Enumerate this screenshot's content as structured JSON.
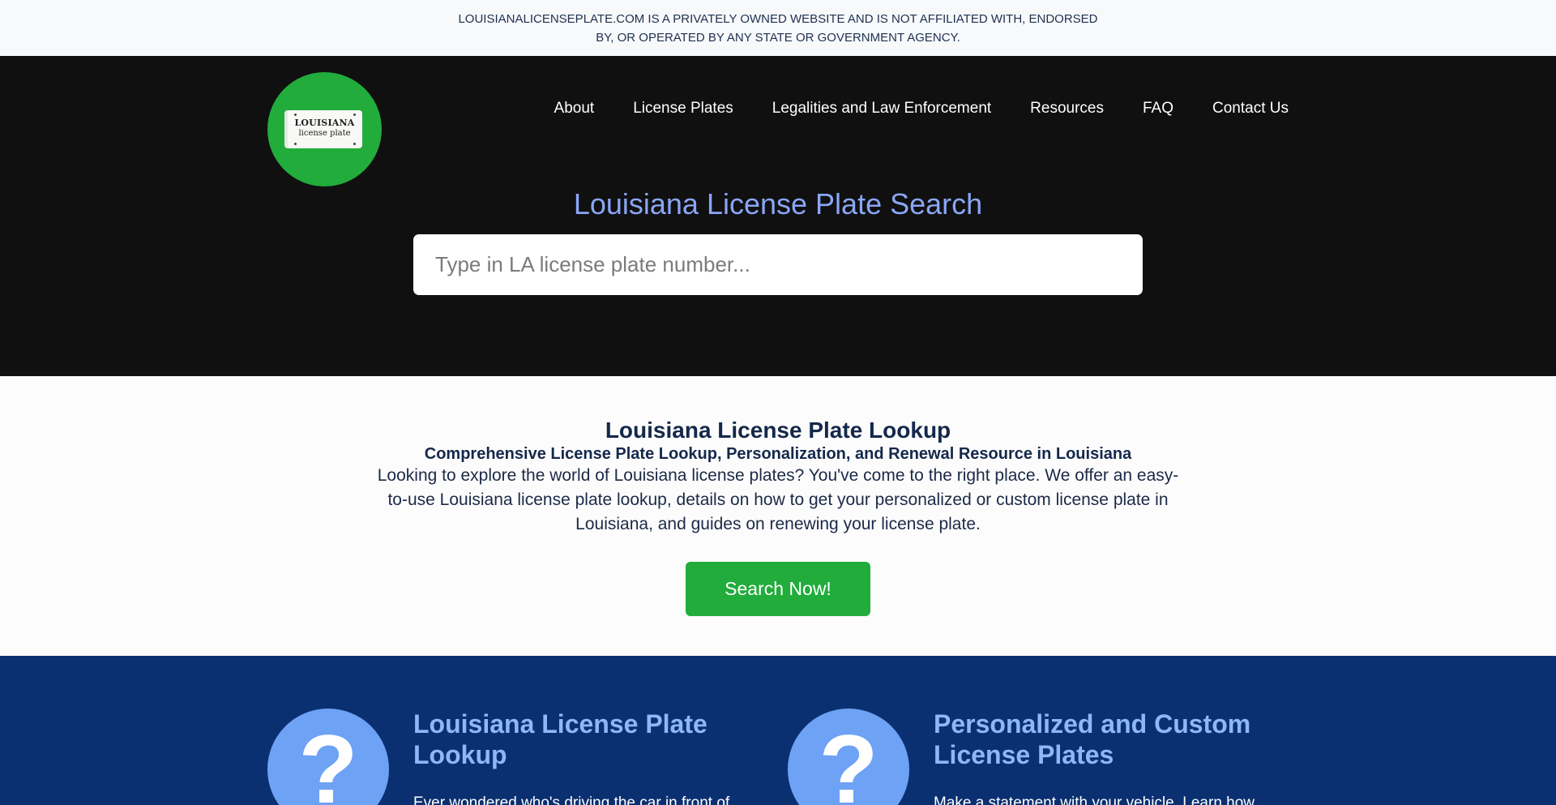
{
  "disclaimer": "LOUISIANALICENSEPLATE.COM IS A PRIVATELY OWNED WEBSITE AND IS NOT AFFILIATED WITH, ENDORSED BY, OR OPERATED BY ANY STATE OR GOVERNMENT AGENCY.",
  "logo": {
    "line1": "LOUISIANA",
    "line2": "license plate"
  },
  "nav": [
    "About",
    "License Plates",
    "Legalities and Law Enforcement",
    "Resources",
    "FAQ",
    "Contact Us"
  ],
  "hero": {
    "title": "Louisiana License Plate Search",
    "search_placeholder": "Type in LA license plate number..."
  },
  "intro": {
    "title": "Louisiana License Plate Lookup",
    "subtitle": "Comprehensive License Plate Lookup, Personalization, and Renewal Resource in Louisiana",
    "body": "Looking to explore the world of Louisiana license plates? You've come to the right place. We offer an easy-to-use Louisiana license plate lookup, details on how to get your personalized or custom license plate in Louisiana, and guides on renewing your license plate.",
    "button": "Search Now!"
  },
  "features": [
    {
      "icon": "question-icon",
      "glyph": "?",
      "title": "Louisiana License Plate Lookup",
      "desc": "Ever wondered who's driving the car in front of"
    },
    {
      "icon": "question-icon",
      "glyph": "?",
      "title": "Personalized and Custom License Plates",
      "desc": "Make a statement with your vehicle. Learn how"
    }
  ],
  "colors": {
    "accent_green": "#21ac3c",
    "hero_title": "#8aa6f7",
    "features_bg": "#0b3071",
    "feature_title": "#8db7f7",
    "question_circle": "#6da2f5"
  }
}
